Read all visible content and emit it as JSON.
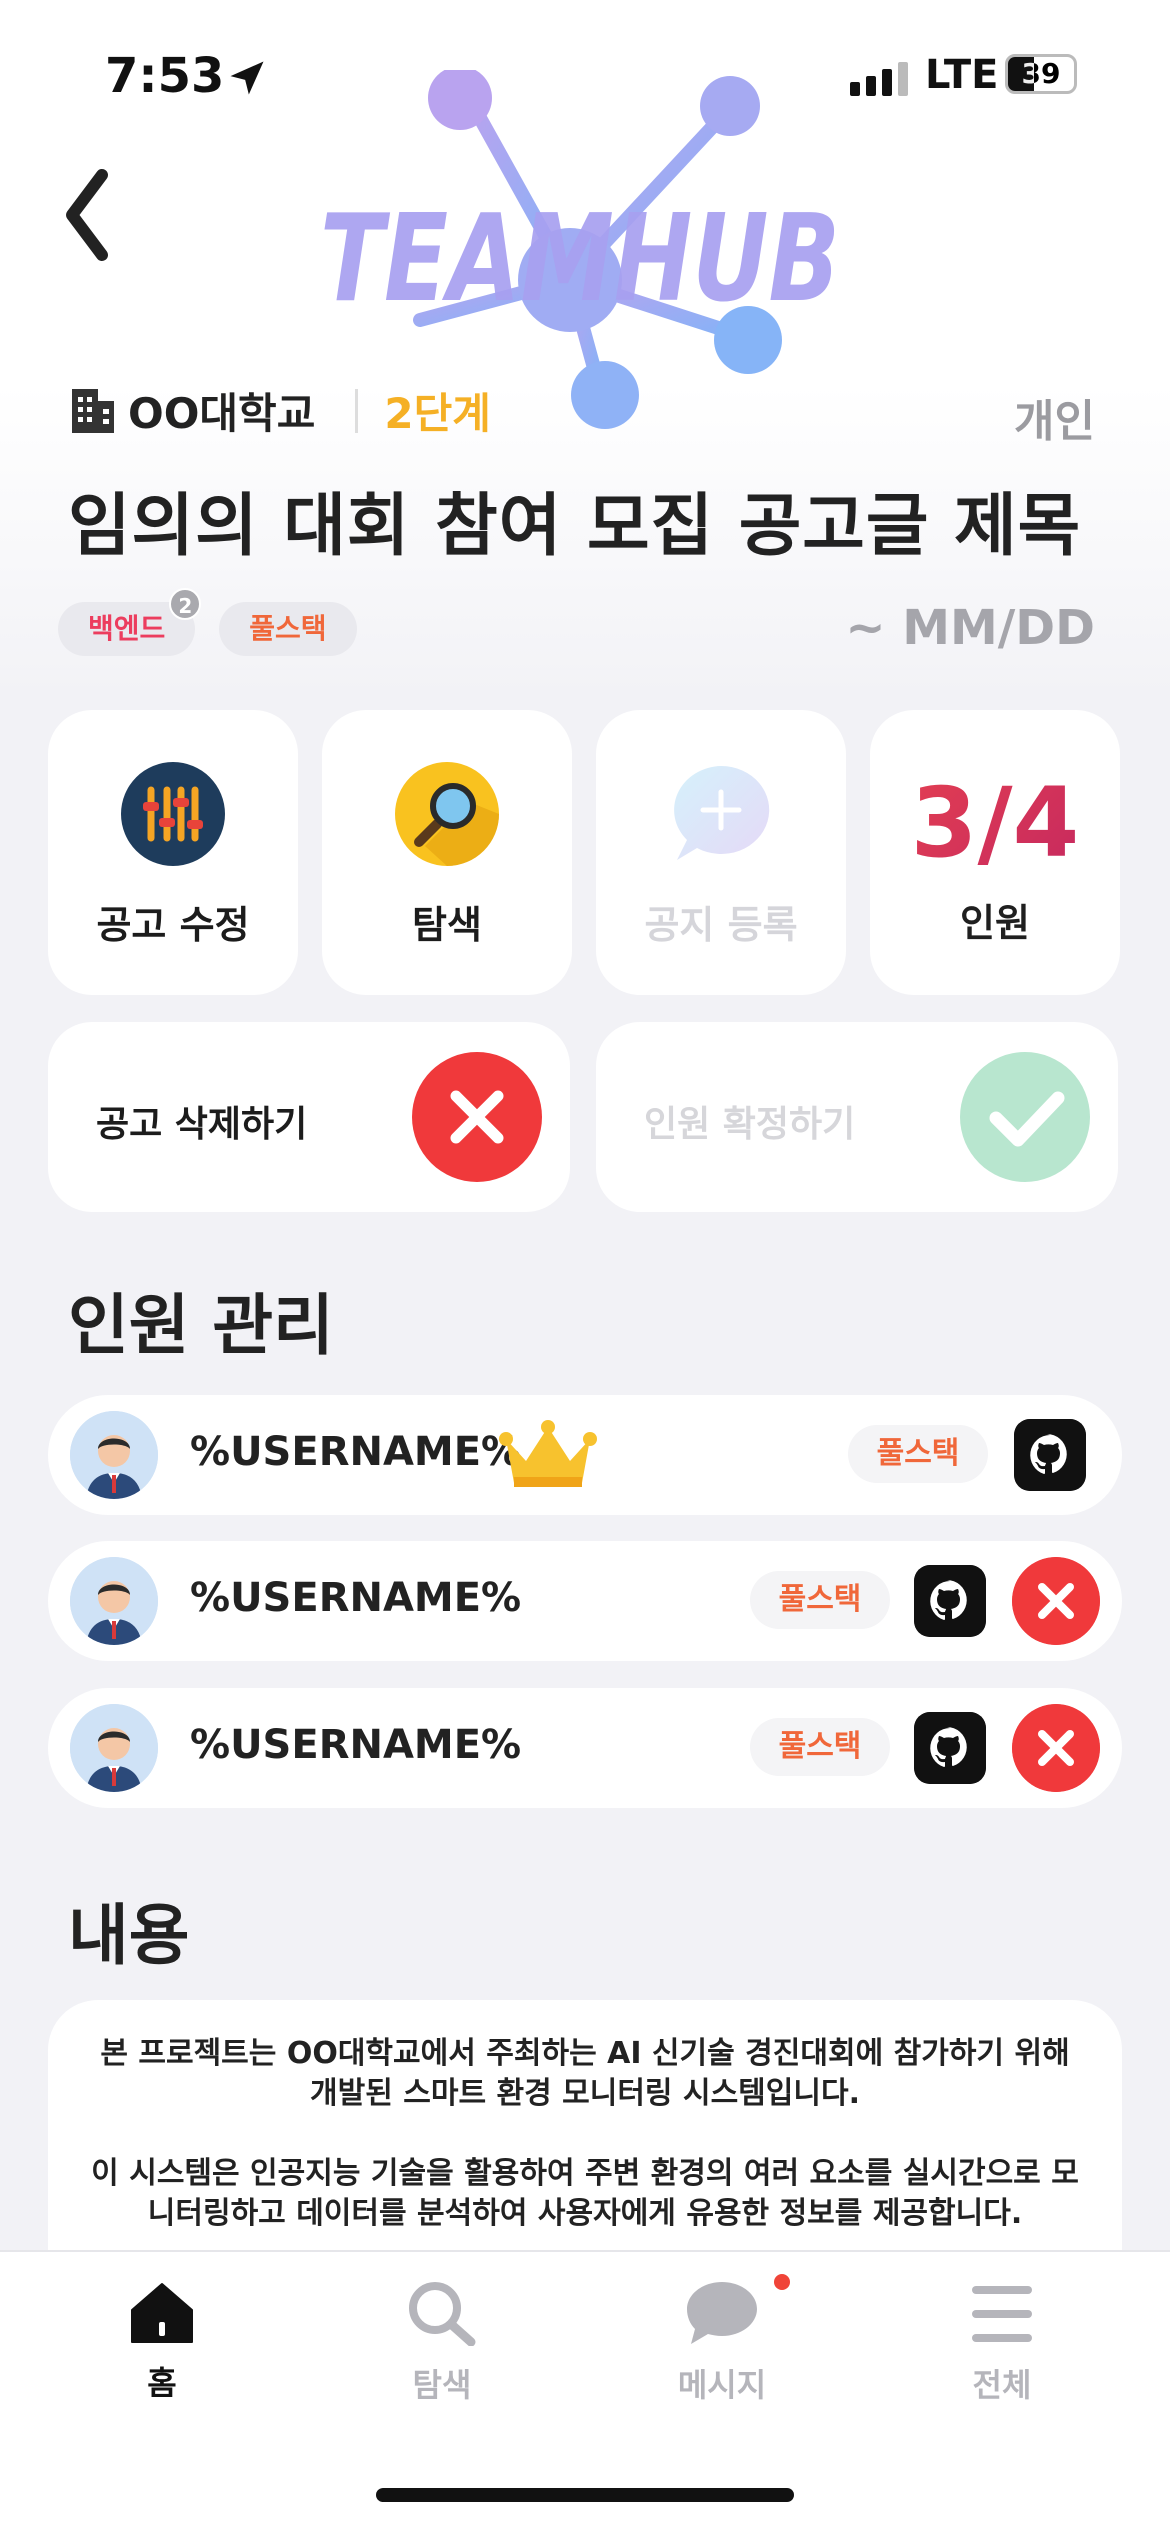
{
  "status_bar": {
    "time": "7:53",
    "network": "LTE",
    "battery": "39",
    "battery_level": 0.39
  },
  "logo_text": "TEAMHUB",
  "post": {
    "university": "OO대학교",
    "stage": "2단계",
    "type": "개인",
    "title": "임의의 대회 참여 모집 공고글 제목",
    "tags": [
      {
        "label": "백엔드",
        "count": "2"
      },
      {
        "label": "풀스택"
      }
    ],
    "deadline": "~ MM/DD"
  },
  "actions": {
    "edit": "공고 수정",
    "explore": "탐색",
    "notice": "공지 등록",
    "members_ratio": "3/4",
    "members_label": "인원",
    "delete": "공고 삭제하기",
    "confirm": "인원 확정하기"
  },
  "member_section_title": "인원 관리",
  "members": [
    {
      "name": "%USERNAME%",
      "role": "풀스택",
      "leader": true
    },
    {
      "name": "%USERNAME%",
      "role": "풀스택",
      "leader": false
    },
    {
      "name": "%USERNAME%",
      "role": "풀스택",
      "leader": false
    }
  ],
  "content_title": "내용",
  "content_paragraphs": [
    "본 프로젝트는 OO대학교에서 주최하는 AI 신기술 경진대회에 참가하기 위해 개발된 스마트 환경 모니터링 시스템입니다.",
    "이 시스템은 인공지능 기술을 활용하여 주변 환경의 여러 요소를 실시간으로 모니터링하고 데이터를 분석하여 사용자에게 유용한 정보를 제공합니다."
  ],
  "tabbar": {
    "home": "홈",
    "search": "탐색",
    "message": "메시지",
    "all": "전체"
  },
  "colors": {
    "accent_yellow": "#f5b025",
    "danger": "#f0393b",
    "success": "#b8e6cf",
    "tag_red": "#ec3d5e",
    "tag_orange": "#f0673a"
  }
}
